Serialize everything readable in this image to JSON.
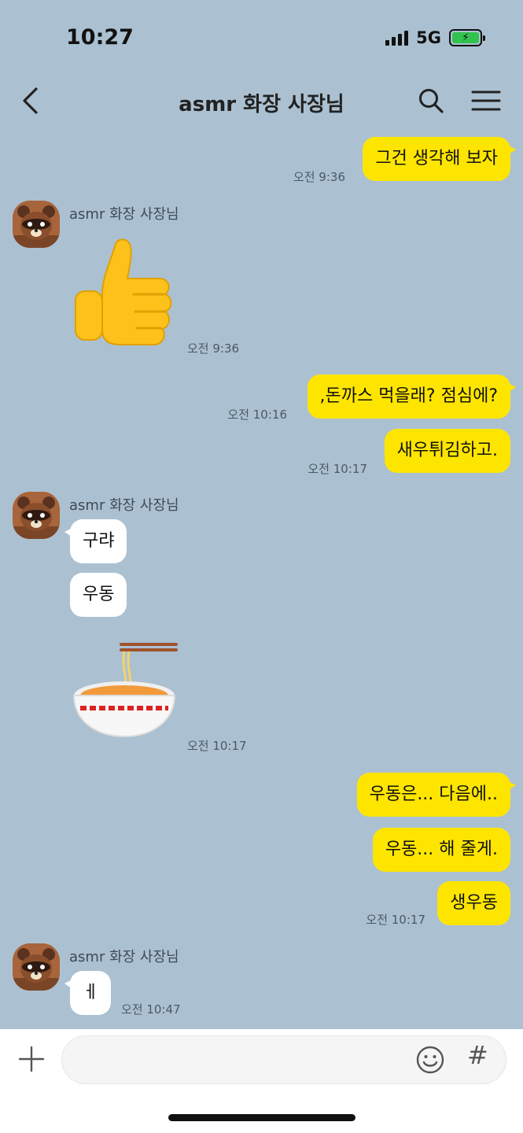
{
  "status_bar": {
    "time": "10:27",
    "network": "5G"
  },
  "header": {
    "title": "asmr 화장 사장님"
  },
  "messages": {
    "m1": {
      "text": "그건 생각해 보자",
      "time": "오전 9:36"
    },
    "g1": {
      "sender": "asmr 화장 사장님",
      "sticker": "thumbs-up",
      "time": "오전 9:36"
    },
    "m2": {
      "text": ",돈까스 먹을래? 점심에?",
      "time": "오전 10:16"
    },
    "m3": {
      "text": "새우튀김하고.",
      "time": "오전 10:17"
    },
    "g2": {
      "sender": "asmr 화장 사장님",
      "texts": [
        "구랴",
        "우동"
      ],
      "sticker": "noodle-bowl",
      "time": "오전 10:17"
    },
    "m4": {
      "text": "우동은... 다음에.."
    },
    "m5": {
      "text": "우동... 해 줄게."
    },
    "m6": {
      "text": "생우동",
      "time": "오전 10:17"
    },
    "g3": {
      "sender": "asmr 화장 사장님",
      "text": "ㅔ",
      "time": "오전 10:47"
    }
  },
  "input": {
    "placeholder": "",
    "value": "",
    "hash": "#"
  },
  "colors": {
    "background": "#abc1d1",
    "my_bubble": "#fee500",
    "other_bubble": "#ffffff"
  }
}
